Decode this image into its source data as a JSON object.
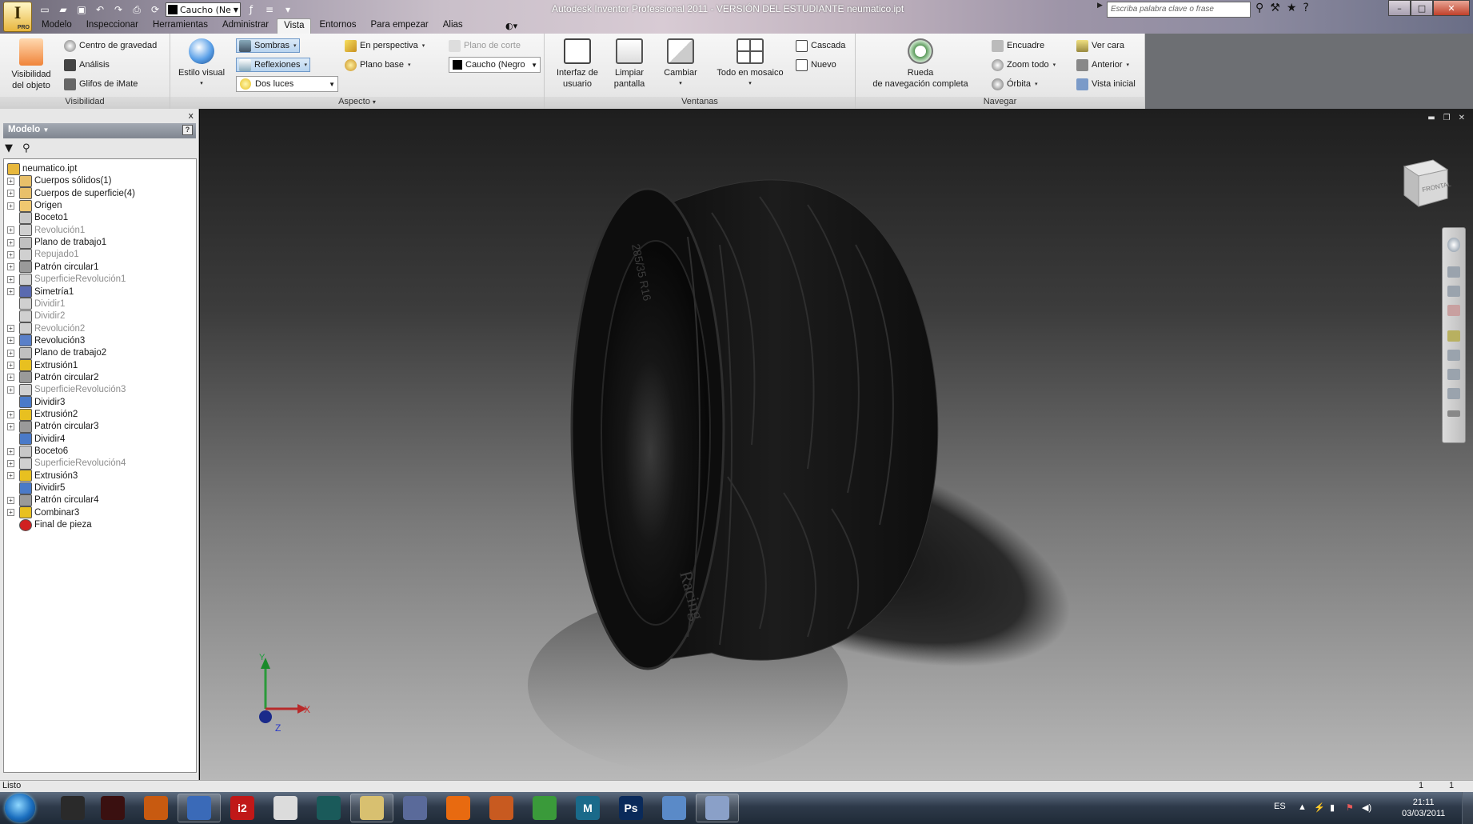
{
  "window": {
    "title": "Autodesk Inventor Professional 2011 - VERSIÓN DEL ESTUDIANTE    neumatico.ipt",
    "search_placeholder": "Escriba palabra clave o frase",
    "app_button_label": "I",
    "app_button_badge": "PRO",
    "material_combo": "Caucho (Ne",
    "controls": [
      "–",
      "□",
      "X"
    ]
  },
  "menu_tabs": [
    "Modelo",
    "Inspeccionar",
    "Herramientas",
    "Administrar",
    "Vista",
    "Entornos",
    "Para empezar",
    "Alias"
  ],
  "active_tab": "Vista",
  "ribbon": {
    "visibilidad": {
      "title": "Visibilidad",
      "big_label_1": "Visibilidad",
      "big_label_2": "del objeto",
      "items": [
        "Centro de gravedad",
        "Análisis",
        "Glifos de iMate"
      ]
    },
    "aspecto": {
      "title": "Aspecto",
      "estilo_label": "Estilo visual",
      "sombras": "Sombras",
      "reflexiones": "Reflexiones",
      "dos_luces": "Dos luces",
      "perspectiva": "En perspectiva",
      "plano_base": "Plano base",
      "plano_corte": "Plano de corte",
      "material": "Caucho (Negro"
    },
    "ventanas": {
      "title": "Ventanas",
      "interfaz_1": "Interfaz de",
      "interfaz_2": "usuario",
      "limpiar_1": "Limpiar",
      "limpiar_2": "pantalla",
      "cambiar": "Cambiar",
      "mosaico": "Todo en mosaico",
      "cascada": "Cascada",
      "nuevo": "Nuevo"
    },
    "navegar": {
      "title": "Navegar",
      "rueda_1": "Rueda",
      "rueda_2": "de navegación completa",
      "encuadre": "Encuadre",
      "zoom": "Zoom todo",
      "orbita": "Órbita",
      "ver_cara": "Ver cara",
      "anterior": "Anterior",
      "vista_inicial": "Vista inicial"
    }
  },
  "browser": {
    "header": "Modelo",
    "help": "?",
    "close": "x",
    "items": [
      {
        "label": "neumatico.ipt",
        "icon": "part-icon",
        "expand": "",
        "dim": false,
        "color": "#e8b83c"
      },
      {
        "label": "Cuerpos sólidos(1)",
        "icon": "folder-icon",
        "expand": "+",
        "dim": false,
        "color": "#e8c06a"
      },
      {
        "label": "Cuerpos de superficie(4)",
        "icon": "folder-icon",
        "expand": "+",
        "dim": false,
        "color": "#e8c06a"
      },
      {
        "label": "Origen",
        "icon": "folder-icon",
        "expand": "+",
        "dim": false,
        "color": "#f0c870"
      },
      {
        "label": "Boceto1",
        "icon": "sketch-icon",
        "expand": "",
        "dim": false,
        "color": "#c8c8c8"
      },
      {
        "label": "Revolución1",
        "icon": "revolve-icon",
        "expand": "+",
        "dim": true,
        "color": "#d0d0d0"
      },
      {
        "label": "Plano de trabajo1",
        "icon": "workplane-icon",
        "expand": "+",
        "dim": false,
        "color": "#c0c0c0"
      },
      {
        "label": "Repujado1",
        "icon": "emboss-icon",
        "expand": "+",
        "dim": true,
        "color": "#d0d0d0"
      },
      {
        "label": "Patrón circular1",
        "icon": "circular-pattern-icon",
        "expand": "+",
        "dim": false,
        "color": "#9a9a9a"
      },
      {
        "label": "SuperficieRevolución1",
        "icon": "surface-icon",
        "expand": "+",
        "dim": true,
        "color": "#d0d0d0"
      },
      {
        "label": "Simetría1",
        "icon": "mirror-icon",
        "expand": "+",
        "dim": false,
        "color": "#5a6ab0"
      },
      {
        "label": "Dividir1",
        "icon": "split-icon",
        "expand": "",
        "dim": true,
        "color": "#d0d0d0"
      },
      {
        "label": "Dividir2",
        "icon": "split-icon",
        "expand": "",
        "dim": true,
        "color": "#d0d0d0"
      },
      {
        "label": "Revolución2",
        "icon": "revolve-icon",
        "expand": "+",
        "dim": true,
        "color": "#d0d0d0"
      },
      {
        "label": "Revolución3",
        "icon": "revolve-icon",
        "expand": "+",
        "dim": false,
        "color": "#5a80c8"
      },
      {
        "label": "Plano de trabajo2",
        "icon": "workplane-icon",
        "expand": "+",
        "dim": false,
        "color": "#c0c0c0"
      },
      {
        "label": "Extrusión1",
        "icon": "extrude-icon",
        "expand": "+",
        "dim": false,
        "color": "#e8c020"
      },
      {
        "label": "Patrón circular2",
        "icon": "circular-pattern-icon",
        "expand": "+",
        "dim": false,
        "color": "#9a9a9a"
      },
      {
        "label": "SuperficieRevolución3",
        "icon": "surface-icon",
        "expand": "+",
        "dim": true,
        "color": "#d0d0d0"
      },
      {
        "label": "Dividir3",
        "icon": "split-icon",
        "expand": "",
        "dim": false,
        "color": "#4a7ac8"
      },
      {
        "label": "Extrusión2",
        "icon": "extrude-icon",
        "expand": "+",
        "dim": false,
        "color": "#e8c020"
      },
      {
        "label": "Patrón circular3",
        "icon": "circular-pattern-icon",
        "expand": "+",
        "dim": false,
        "color": "#9a9a9a"
      },
      {
        "label": "Dividir4",
        "icon": "split-icon",
        "expand": "",
        "dim": false,
        "color": "#4a7ac8"
      },
      {
        "label": "Boceto6",
        "icon": "sketch-icon",
        "expand": "+",
        "dim": false,
        "color": "#c8c8c8"
      },
      {
        "label": "SuperficieRevolución4",
        "icon": "surface-icon",
        "expand": "+",
        "dim": true,
        "color": "#d0d0d0"
      },
      {
        "label": "Extrusión3",
        "icon": "extrude-icon",
        "expand": "+",
        "dim": false,
        "color": "#e8c020"
      },
      {
        "label": "Dividir5",
        "icon": "split-icon",
        "expand": "",
        "dim": false,
        "color": "#4a7ac8"
      },
      {
        "label": "Patrón circular4",
        "icon": "circular-pattern-icon",
        "expand": "+",
        "dim": false,
        "color": "#9a9a9a"
      },
      {
        "label": "Combinar3",
        "icon": "combine-icon",
        "expand": "+",
        "dim": false,
        "color": "#e8c020"
      },
      {
        "label": "Final de pieza",
        "icon": "end-of-part-icon",
        "expand": "",
        "dim": false,
        "color": "#d02020"
      }
    ]
  },
  "viewport": {
    "viewcube_label": "FRONTAL",
    "tire_sidewall_text": "Racing",
    "tire_size_text": "285/35 R16",
    "axis": {
      "x": "X",
      "y": "Y",
      "z": "Z"
    }
  },
  "status": {
    "text": "Listo",
    "count1": "1",
    "count2": "1"
  },
  "taskbar": {
    "apps": [
      {
        "icon": "spotify-icon",
        "label": "",
        "color": "#2a2a2a",
        "open": false
      },
      {
        "icon": "app-icon",
        "label": "",
        "color": "#3a1010",
        "open": false
      },
      {
        "icon": "firefox-icon",
        "label": "",
        "color": "#c85a10",
        "open": false
      },
      {
        "icon": "windows-icon",
        "label": "",
        "color": "#3a6ab8",
        "open": true
      },
      {
        "icon": "i2-icon",
        "label": "i2",
        "color": "#c01818",
        "open": false
      },
      {
        "icon": "document-icon",
        "label": "",
        "color": "#dcdcdc",
        "open": false
      },
      {
        "icon": "max-icon",
        "label": "",
        "color": "#1a5a5a",
        "open": false
      },
      {
        "icon": "inventor-icon",
        "label": "",
        "color": "#d8c070",
        "open": true
      },
      {
        "icon": "app-icon",
        "label": "",
        "color": "#5a6a9a",
        "open": false
      },
      {
        "icon": "blender-icon",
        "label": "",
        "color": "#e86a10",
        "open": false
      },
      {
        "icon": "matlab-icon",
        "label": "",
        "color": "#c85a20",
        "open": false
      },
      {
        "icon": "chrome-icon",
        "label": "",
        "color": "#3a9a3a",
        "open": false
      },
      {
        "icon": "maya-icon",
        "label": "M",
        "color": "#1a6a8a",
        "open": false
      },
      {
        "icon": "photoshop-icon",
        "label": "Ps",
        "color": "#0a2a5a",
        "open": false
      },
      {
        "icon": "users-icon",
        "label": "",
        "color": "#5a8ac8",
        "open": false
      },
      {
        "icon": "paint-icon",
        "label": "",
        "color": "#8aa0c8",
        "open": true
      }
    ],
    "lang": "ES",
    "time": "21:11",
    "date": "03/03/2011"
  }
}
